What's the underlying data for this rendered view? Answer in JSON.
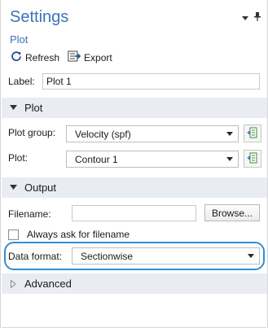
{
  "panel": {
    "title": "Settings",
    "subtitle": "Plot",
    "toolbar": {
      "refresh_label": "Refresh",
      "export_label": "Export"
    }
  },
  "label_field": {
    "label": "Label:",
    "value": "Plot 1"
  },
  "sections": {
    "plot": {
      "title": "Plot",
      "expanded": true
    },
    "output": {
      "title": "Output",
      "expanded": true
    },
    "advanced": {
      "title": "Advanced",
      "expanded": false
    }
  },
  "plot_section": {
    "plot_group_label": "Plot group:",
    "plot_group_value": "Velocity (spf)",
    "plot_label": "Plot:",
    "plot_value": "Contour 1"
  },
  "output_section": {
    "filename_label": "Filename:",
    "filename_value": "",
    "browse_label": "Browse...",
    "always_ask_label": "Always ask for filename",
    "always_ask_checked": false,
    "data_format_label": "Data format:",
    "data_format_value": "Sectionwise"
  },
  "colors": {
    "accent": "#3b73b9",
    "section_bg": "#e9edf3",
    "highlight": "#2f8fd3"
  },
  "icons": {
    "refresh": "refresh-icon",
    "export": "export-icon",
    "dropdown": "chevron-down-icon",
    "pin": "pin-icon",
    "goto": "go-to-source-icon"
  }
}
